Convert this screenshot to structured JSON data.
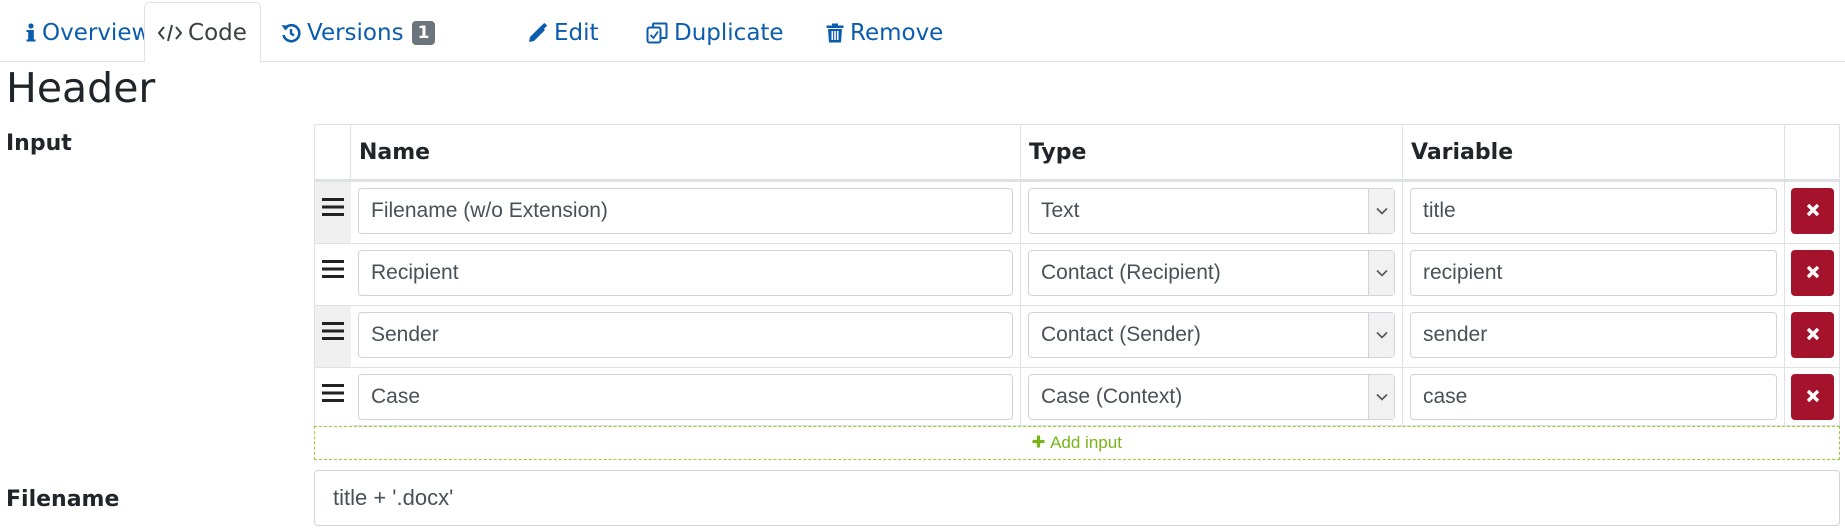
{
  "tabs": [
    {
      "label": "Overview",
      "icon": "info-icon"
    },
    {
      "label": "Code",
      "icon": "code-icon"
    },
    {
      "label": "Versions",
      "icon": "history-icon",
      "badge": "1"
    },
    {
      "label": "Edit",
      "icon": "pencil-icon"
    },
    {
      "label": "Duplicate",
      "icon": "copy-icon"
    },
    {
      "label": "Remove",
      "icon": "trash-icon"
    }
  ],
  "active_tab": "Code",
  "page_title": "Header",
  "input_section": {
    "label": "Input",
    "columns": {
      "name": "Name",
      "type": "Type",
      "variable": "Variable"
    },
    "rows": [
      {
        "name": "Filename (w/o Extension)",
        "type": "Text",
        "variable": "title"
      },
      {
        "name": "Recipient",
        "type": "Contact (Recipient)",
        "variable": "recipient"
      },
      {
        "name": "Sender",
        "type": "Contact (Sender)",
        "variable": "sender"
      },
      {
        "name": "Case",
        "type": "Case (Context)",
        "variable": "case"
      }
    ],
    "add_label": "Add input"
  },
  "filename": {
    "label": "Filename",
    "value": "title + '.docx'"
  },
  "colors": {
    "link": "#0b5cad",
    "delete": "#a5122b",
    "add": "#7ab317",
    "badge": "#6c757d"
  }
}
